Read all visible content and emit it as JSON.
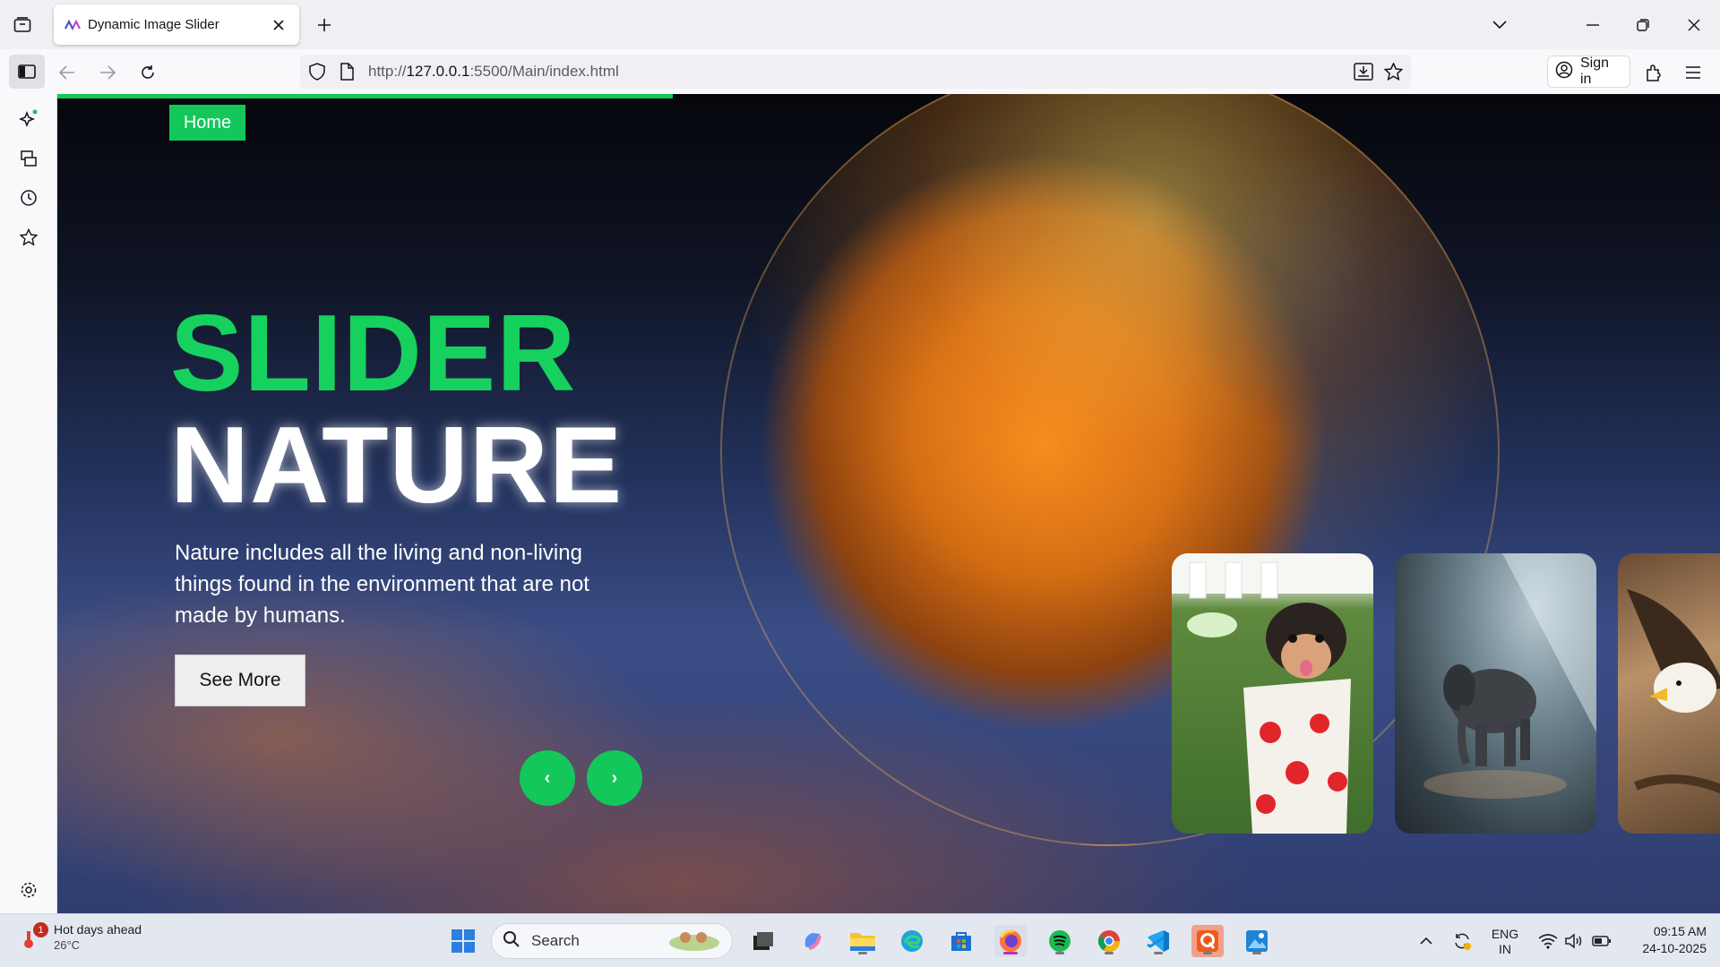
{
  "browser": {
    "tab_title": "Dynamic Image Slider",
    "url_scheme": "http://",
    "url_host": "127.0.0.1",
    "url_rest": ":5500/Main/index.html",
    "sign_in_label": "Sign in"
  },
  "page": {
    "nav_home": "Home",
    "title_line1": "SLIDER",
    "title_line2": "NATURE",
    "description": "Nature includes all the living and non-living things found in the environment that are not made by humans.",
    "see_more_label": "See More",
    "prev_label": "‹",
    "next_label": "›",
    "progress_fraction": 0.37,
    "accent_color": "#14c75b"
  },
  "taskbar": {
    "weather_title": "Hot days ahead",
    "weather_temp": "26°C",
    "weather_badge": "1",
    "search_label": "Search",
    "lang_line1": "ENG",
    "lang_line2": "IN",
    "time": "09:15 AM",
    "date": "24-10-2025"
  }
}
